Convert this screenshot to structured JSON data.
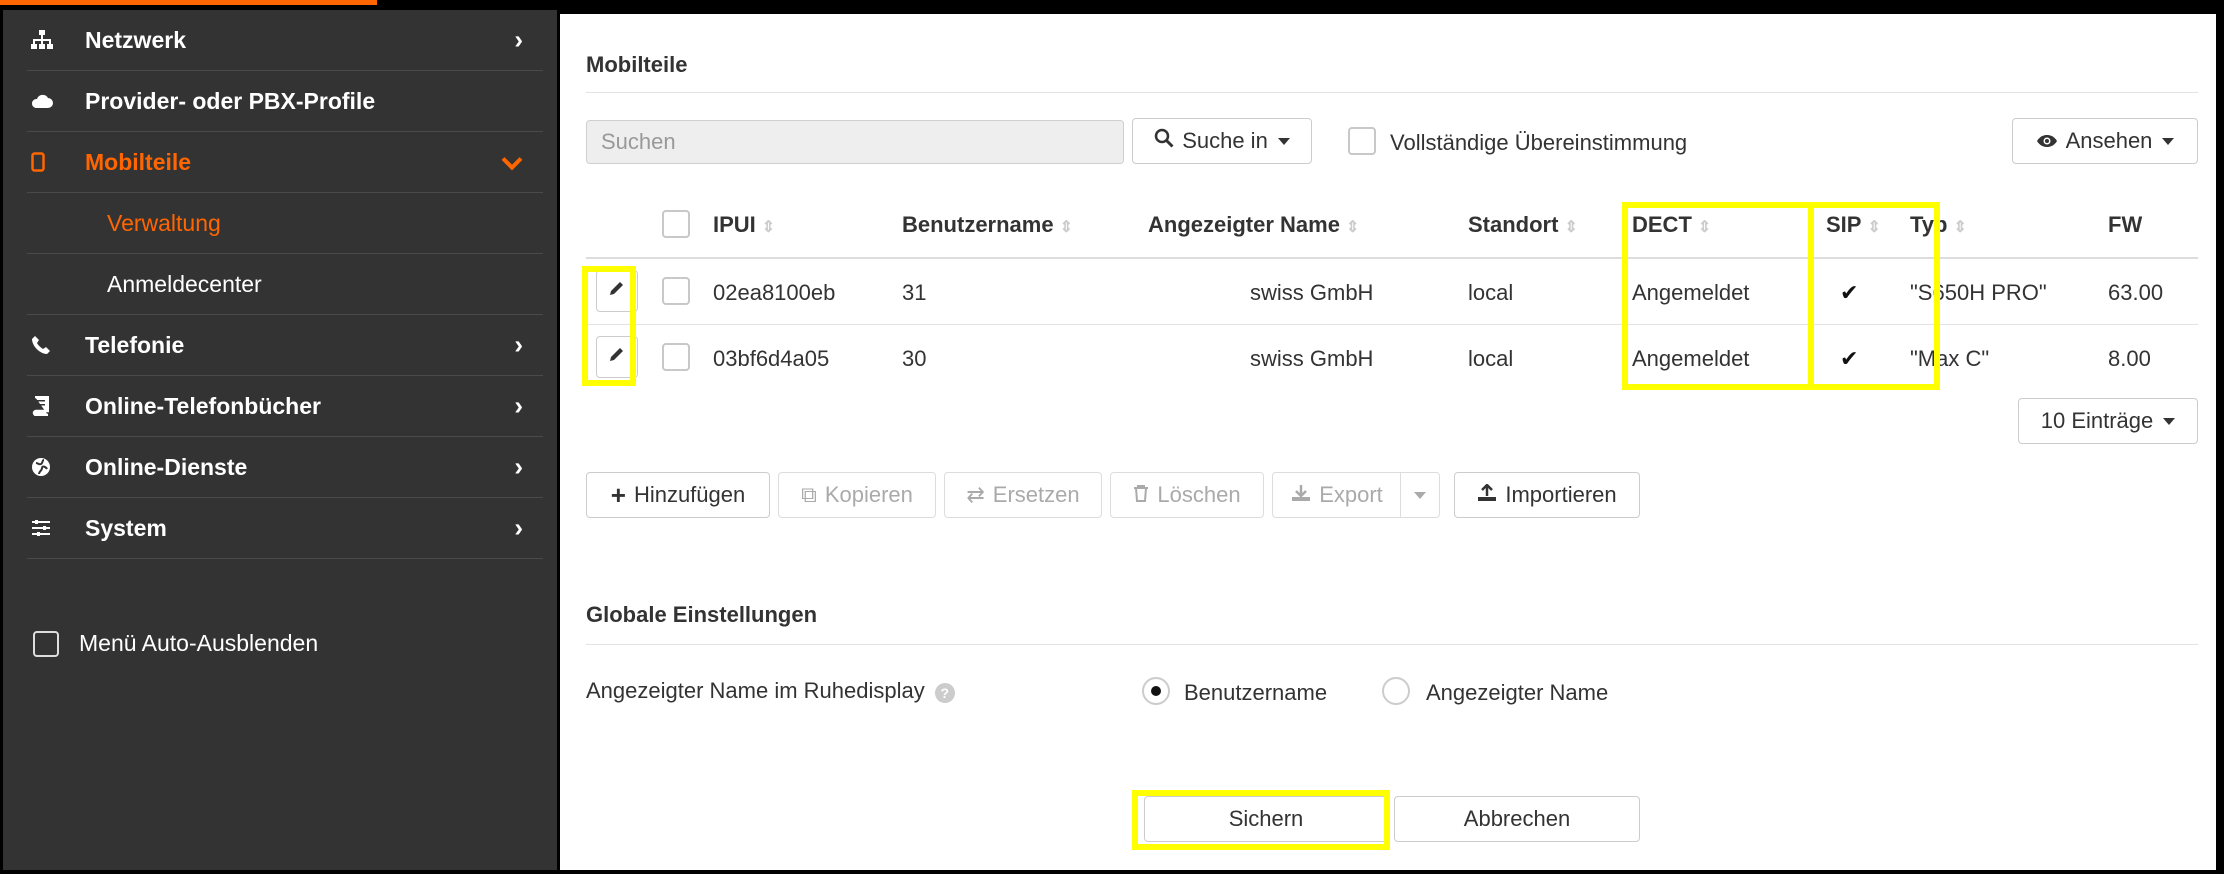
{
  "sidebar": {
    "items": [
      {
        "label": "Netzwerk",
        "icon": "network-icon"
      },
      {
        "label": "Provider- oder PBX-Profile",
        "icon": "cloud-icon"
      },
      {
        "label": "Mobilteile",
        "icon": "handset-icon",
        "active": true
      },
      {
        "label": "Telefonie",
        "icon": "phone-icon"
      },
      {
        "label": "Online-Telefonbücher",
        "icon": "book-icon"
      },
      {
        "label": "Online-Dienste",
        "icon": "globe-icon"
      },
      {
        "label": "System",
        "icon": "sliders-icon"
      }
    ],
    "subitems": [
      {
        "label": "Verwaltung",
        "active": true
      },
      {
        "label": "Anmeldecenter"
      }
    ],
    "autohide_label": "Menü Auto-Ausblenden"
  },
  "main": {
    "title": "Mobilteile",
    "search": {
      "placeholder": "Suchen",
      "search_in_label": "Suche in"
    },
    "exact_match_label": "Vollständige Übereinstimmung",
    "view_label": "Ansehen",
    "table": {
      "columns": [
        "IPUI",
        "Benutzername",
        "Angezeigter Name",
        "Standort",
        "DECT",
        "SIP",
        "Typ",
        "FW"
      ],
      "rows": [
        {
          "ipui": "02ea8100eb",
          "user": "31",
          "display": "swiss GmbH",
          "location": "local",
          "dect": "Angemeldet",
          "sip": "✔",
          "type": "\"S650H PRO\"",
          "fw": "63.00"
        },
        {
          "ipui": "03bf6d4a05",
          "user": "30",
          "display": "swiss GmbH",
          "location": "local",
          "dect": "Angemeldet",
          "sip": "✔",
          "type": "\"Max C\"",
          "fw": "8.00"
        }
      ]
    },
    "entries_label": "10 Einträge",
    "actions": {
      "add": "Hinzufügen",
      "copy": "Kopieren",
      "replace": "Ersetzen",
      "delete": "Löschen",
      "export": "Export",
      "import": "Importieren"
    },
    "global": {
      "title": "Globale Einstellungen",
      "display_label": "Angezeigter Name im Ruhedisplay",
      "options": [
        "Benutzername",
        "Angezeigter Name"
      ],
      "selected": "Benutzername"
    },
    "save_label": "Sichern",
    "cancel_label": "Abbrechen"
  },
  "colors": {
    "accent": "#ff6600",
    "sidebar_bg": "#333333",
    "highlight": "#ffff00"
  }
}
